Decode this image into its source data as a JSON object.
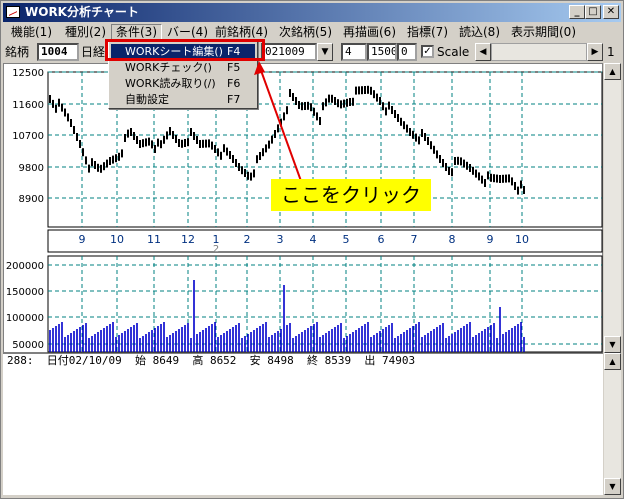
{
  "window": {
    "title": "WORK分析チャート",
    "buttons": {
      "minimize": "_",
      "maximize": "□",
      "close": "✕"
    }
  },
  "menubar": {
    "items": [
      "機能(1)",
      "種別(2)",
      "条件(3)",
      "バー(4)",
      "前銘柄(4)",
      "次銘柄(5)",
      "再描画(6)",
      "指標(7)",
      "読込(8)",
      "表示期間(0)"
    ]
  },
  "toolbar": {
    "stock_label": "銘柄",
    "stock_code": "1004",
    "period_label": "日経",
    "date_value": "021009",
    "field1": "4",
    "field2": "1500",
    "field3": "0",
    "scale_label": "Scale",
    "page_number": "1"
  },
  "dropdown": {
    "items": [
      {
        "label": "WORKシート編集()",
        "key": "F4"
      },
      {
        "label": "WORKチェック()",
        "key": "F5"
      },
      {
        "label": "WORK読み取り(/)",
        "key": "F6"
      },
      {
        "label": "自動設定",
        "key": "F7"
      }
    ]
  },
  "callout": {
    "text": "ここをクリック"
  },
  "price_chart": {
    "ytick_labels": [
      "12500",
      "11600",
      "10700",
      "9800",
      "8900"
    ],
    "month_labels": [
      "9",
      "10",
      "11",
      "12",
      "1",
      "2",
      "3",
      "4",
      "5",
      "6",
      "7",
      "8",
      "9",
      "10"
    ],
    "year_marker": "2"
  },
  "volume_chart": {
    "ytick_labels": [
      "200000",
      "150000",
      "100000",
      "50000"
    ]
  },
  "status_line": {
    "text": "288:  日付02/10/09  始 8649  高 8652  安 8498  終 8539  出 74903"
  },
  "colors": {
    "up_candle": "#e00000",
    "down_candle": "#000000",
    "volume": "#0000cc",
    "grid": "#008080",
    "title_bar": "#0a246a",
    "highlight": "#e00000",
    "callout": "#ffff00"
  }
}
